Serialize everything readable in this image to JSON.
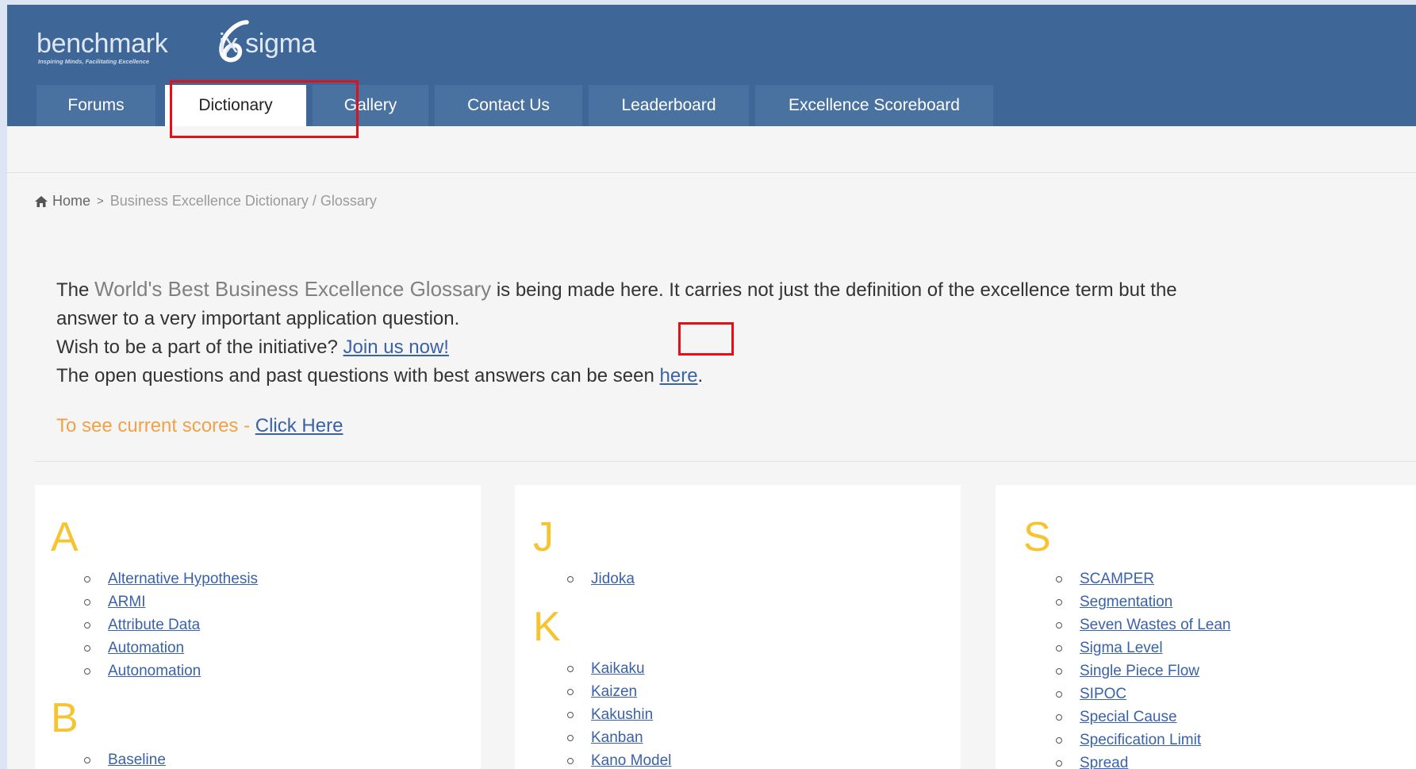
{
  "brand": {
    "name_before": "benchmark",
    "name_after": "ix sigma",
    "tagline": "Inspiring Minds, Facilitating Excellence"
  },
  "nav": {
    "tabs": [
      {
        "label": "Forums"
      },
      {
        "label": "Dictionary"
      },
      {
        "label": "Gallery"
      },
      {
        "label": "Contact Us"
      },
      {
        "label": "Leaderboard"
      },
      {
        "label": "Excellence Scoreboard"
      }
    ]
  },
  "breadcrumb": {
    "home": "Home",
    "separator": ">",
    "current": "Business Excellence Dictionary / Glossary"
  },
  "intro": {
    "line1_pre": "The ",
    "line1_highlight": "World's Best Business Excellence Glossary",
    "line1_post": " is being made here. It carries not just the definition of the excellence term but the",
    "line2": "answer to a very important application question.",
    "line3_pre": "Wish to be a part of the initiative? ",
    "line3_link": "Join us now!",
    "line4_pre": "The open questions and past questions with best answers can be seen ",
    "line4_link": "here",
    "line4_post": "."
  },
  "scores": {
    "text": "To see current scores - ",
    "link": "Click Here"
  },
  "columns": [
    {
      "groups": [
        {
          "letter": "A",
          "terms": [
            "Alternative Hypothesis",
            "ARMI",
            "Attribute Data",
            "Automation",
            "Autonomation"
          ]
        },
        {
          "letter": "B",
          "terms": [
            "Baseline"
          ]
        }
      ]
    },
    {
      "groups": [
        {
          "letter": "J",
          "terms": [
            "Jidoka"
          ]
        },
        {
          "letter": "K",
          "terms": [
            "Kaikaku",
            "Kaizen",
            "Kakushin",
            "Kanban",
            "Kano Model"
          ]
        }
      ]
    },
    {
      "groups": [
        {
          "letter": "S",
          "terms": [
            "SCAMPER",
            "Segmentation",
            "Seven Wastes of Lean",
            "Sigma Level",
            "Single Piece Flow",
            "SIPOC",
            "Special Cause",
            "Specification Limit",
            "Spread"
          ]
        }
      ]
    }
  ],
  "colors": {
    "header": "#3e6696",
    "tab": "#4a72a1",
    "highlight_box": "#e3101a",
    "letter": "#f6c431",
    "link": "#3a62a8",
    "scores_text": "#f0a246"
  }
}
